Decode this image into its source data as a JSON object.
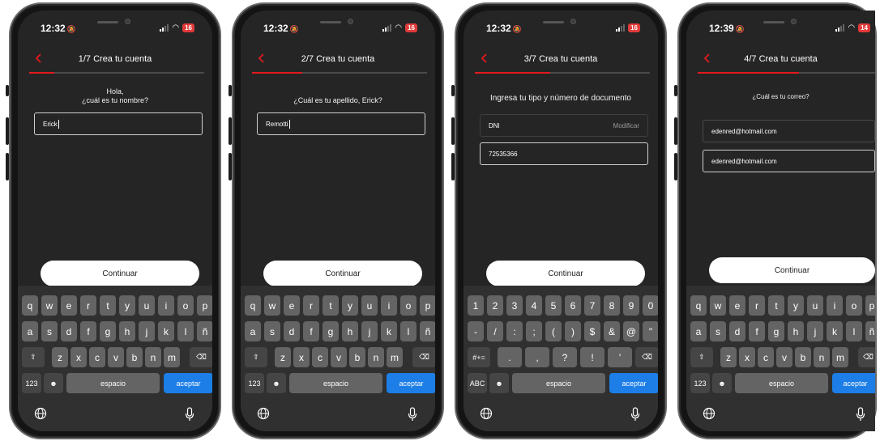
{
  "status": {
    "battery_low": "16",
    "battery_last": "14",
    "battery_color": "#e23a3a"
  },
  "accent": "#e2191f",
  "continue_label": "Continuar",
  "keyboard": {
    "num_key": "123",
    "abc_key": "ABC",
    "symbols_key": "#+=",
    "space": "espacio",
    "accept": "aceptar",
    "letter_row1": [
      "q",
      "w",
      "e",
      "r",
      "t",
      "y",
      "u",
      "i",
      "o",
      "p"
    ],
    "letter_row2": [
      "a",
      "s",
      "d",
      "f",
      "g",
      "h",
      "j",
      "k",
      "l",
      "ñ"
    ],
    "letter_row3": [
      "z",
      "x",
      "c",
      "v",
      "b",
      "n",
      "m"
    ],
    "num_row1": [
      "1",
      "2",
      "3",
      "4",
      "5",
      "6",
      "7",
      "8",
      "9",
      "0"
    ],
    "num_row2": [
      "-",
      "/",
      ":",
      ";",
      "(",
      ")",
      "$",
      "&",
      "@",
      "\""
    ],
    "num_row3": [
      ".",
      ",",
      "?",
      "!",
      "'"
    ]
  },
  "screens": [
    {
      "time": "12:32",
      "title": "1/7 Crea tu cuenta",
      "progress": 0.143,
      "question_line1": "Hola,",
      "question_line2": "¿cuál es tu nombre?",
      "input_value": "Erick"
    },
    {
      "time": "12:32",
      "title": "2/7 Crea tu cuenta",
      "progress": 0.286,
      "question": "¿Cuál es tu apellido, Erick?",
      "input_value": "Remotti"
    },
    {
      "time": "12:32",
      "title": "3/7 Crea tu cuenta",
      "progress": 0.429,
      "question": "Ingresa tu tipo y número de documento",
      "doc_type": "DNI",
      "doc_modify": "Modificar",
      "doc_number": "72535366"
    },
    {
      "time": "12:39",
      "title": "4/7 Crea tu cuenta",
      "progress": 0.571,
      "question": "¿Cuál es tu correo?",
      "email": "edenred@hotmail.com",
      "email_confirm": "edenred@hotmail.com"
    }
  ]
}
